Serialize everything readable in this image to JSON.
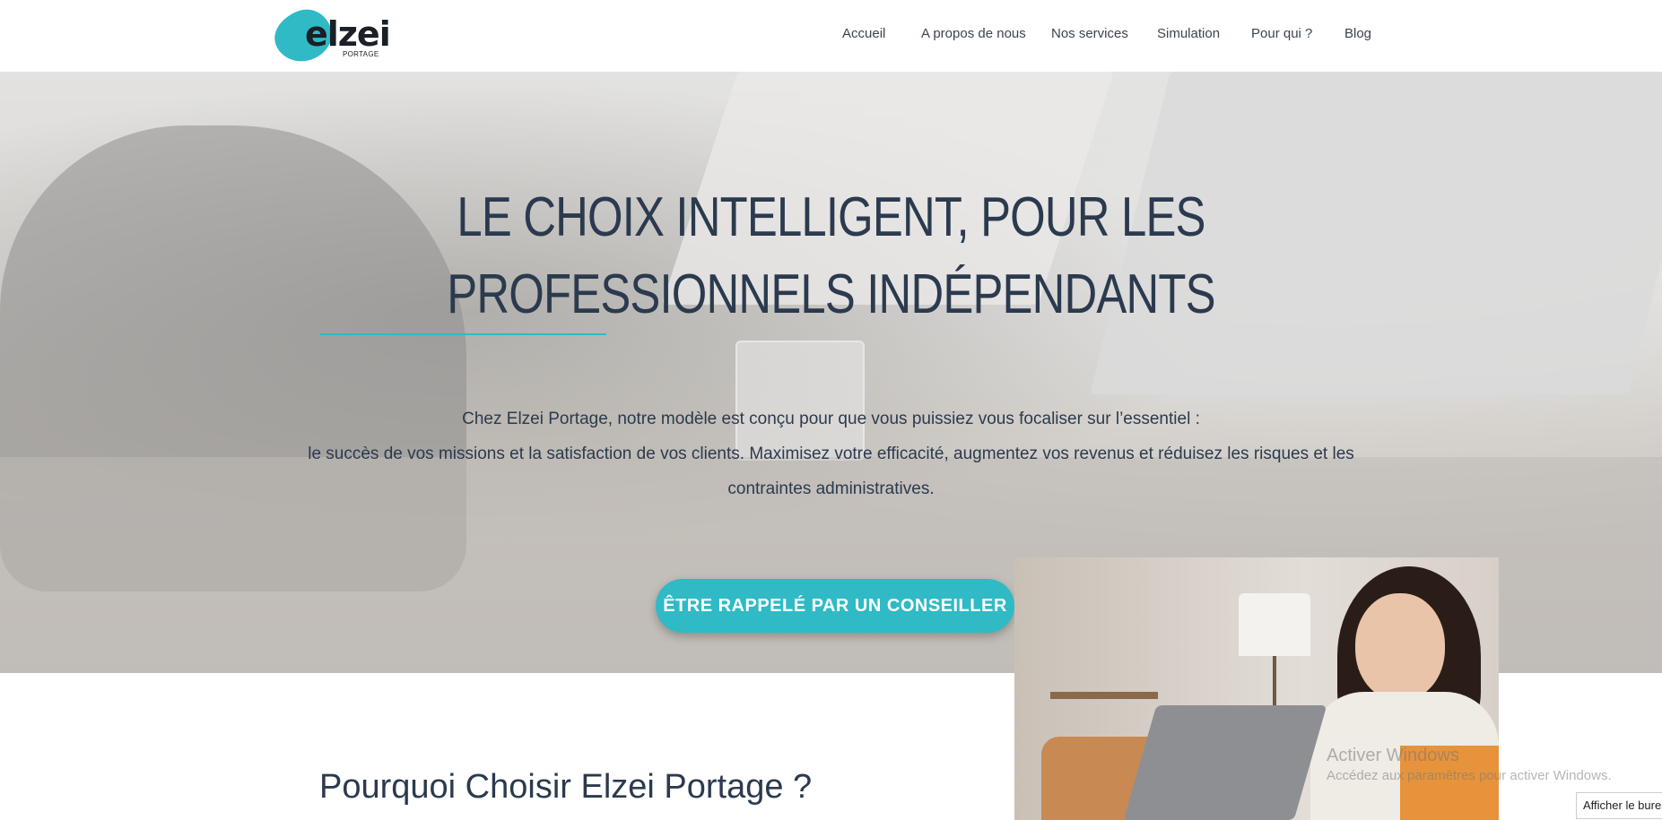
{
  "brand": {
    "logo_main": "elzei",
    "logo_sub": "PORTAGE"
  },
  "nav": {
    "items": [
      {
        "label": "Accueil"
      },
      {
        "label": "A propos de nous"
      },
      {
        "label": "Nos services"
      },
      {
        "label": "Simulation"
      },
      {
        "label": "Pour qui ?"
      },
      {
        "label": "Blog"
      }
    ]
  },
  "hero": {
    "title_line1": "LE CHOIX INTELLIGENT, POUR LES",
    "title_line2": "PROFESSIONNELS INDÉPENDANTS",
    "text_line1": "Chez Elzei Portage, notre modèle est conçu pour que vous puissiez vous focaliser sur l’essentiel :",
    "text_line2": "le succès de vos missions et la satisfaction de vos clients. Maximisez votre efficacité, augmentez vos revenus et réduisez les risques et les",
    "text_line3": "contraintes administratives.",
    "cta_label": "ÊTRE RAPPELÉ PAR UN CONSEILLER"
  },
  "section": {
    "title": "Pourquoi Choisir Elzei Portage ?"
  },
  "os_overlay": {
    "activate_title": "Activer Windows",
    "activate_sub": "Accédez aux paramètres pour activer Windows.",
    "show_desktop": "Afficher le bureau"
  },
  "colors": {
    "accent": "#2fbac6",
    "text_dark": "#2b3a4e"
  }
}
